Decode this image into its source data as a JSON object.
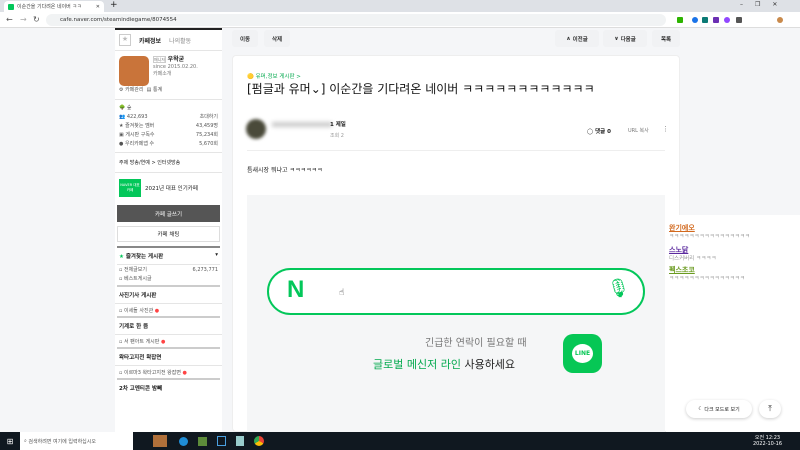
{
  "browser": {
    "tab_title": "이순간을 기다려온 네이버 ㅋㅋ",
    "url": "cafe.naver.com/steamindiegame/8074554"
  },
  "sidebar": {
    "tabs": [
      "카페정보",
      "나의활동"
    ],
    "manager_badge": "매니저",
    "cafe_owner": "우왁굳",
    "since": "since 2015.02.20.",
    "cafe_intro": "카페소개",
    "manage": "카페관리",
    "stats": "통계",
    "level": "숲",
    "members": "422,693",
    "invite": "초대하기",
    "stats_rows": [
      {
        "label": "즐겨찾는 멤버",
        "value": "43,459명"
      },
      {
        "label": "게시판 구독수",
        "value": "75,234회"
      },
      {
        "label": "우리카페앱 수",
        "value": "5,670회"
      }
    ],
    "theme": "주제  방송/연예 > 인터넷방송",
    "award_badge": "NAVER 대표카페",
    "award": "2021년 대표 인기카페",
    "write_button": "카페 글쓰기",
    "chat_button": "카페 채팅",
    "fav_header": "즐겨찾는 게시판",
    "all_posts": "전체글보기",
    "all_count": "6,273,771",
    "best": "베스트게시글",
    "sections": [
      {
        "title": "사진기사 게시판",
        "item": "이세돌 사진관"
      },
      {
        "title": "기계로 한 뜸",
        "item": "서 팬아트 게시판"
      },
      {
        "title": "왁타고지전 왁잡면",
        "item": "이르마3 왁타고지전 왕잡면"
      },
      {
        "title": "2차 고멘티콘 밤뻬",
        "item": ""
      }
    ]
  },
  "toolbar": {
    "move": "이동",
    "delete": "삭제",
    "prev": "이전글",
    "next": "다음글",
    "list": "목록"
  },
  "article": {
    "board": "유머,정보 게시판 >",
    "title": "[펌글과 유머⌄] 이순간을 기다려온 네이버 ㅋㅋㅋㅋㅋㅋㅋㅋㅋㅋㅋㅋ",
    "rank": "1 제일",
    "views": "조회 2",
    "comments": "댓글 0",
    "url_copy": "URL 복사",
    "body": "틈새시장 뭐냐고 ㅋㅋㅋㅋㅋㅋ",
    "ad": {
      "logo": "N",
      "line1": "긴급한 연락이 필요할 때",
      "line2_green": "글로벌 메신저 라인",
      "line2_rest": " 사용하세요",
      "line_logo": "LINE"
    }
  },
  "comments": [
    {
      "name": "완기에오",
      "color": "#d2691e",
      "text": "ㅋㅋㅋㅋㅋㅋㅋㅋㅋㅋㅋㅋㅋㅋㅋㅋ"
    },
    {
      "name": "스노닭",
      "color": "#5b2a9e",
      "text": "디스커버리 ㅋㅋㅋㅋ"
    },
    {
      "name": "펙스초코",
      "color": "#6a9a1f",
      "text": "ㅋㅋㅋㅋㅋㅋㅋㅋㅋㅋㅋㅋㅋㅋㅋ"
    }
  ],
  "floating": {
    "dark_mode": "다크 모드로 보기"
  },
  "taskbar": {
    "search": "검색하려면 여기에 입력하십시오",
    "time": "오전 12:23",
    "date": "2022-10-16"
  }
}
